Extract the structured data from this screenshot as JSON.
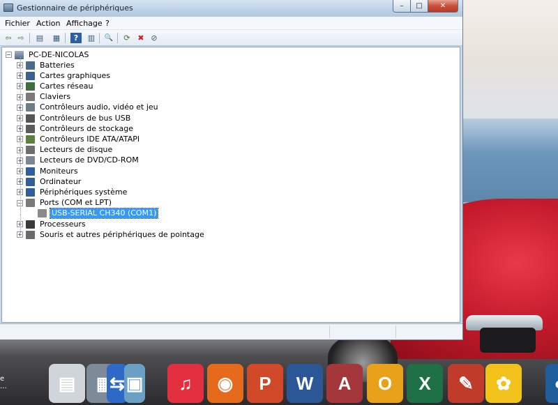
{
  "window": {
    "title": "Gestionnaire de périphériques",
    "buttons": {
      "minimize": "–",
      "maximize": "□",
      "close": "✕"
    }
  },
  "menu": {
    "items": [
      "Fichier",
      "Action",
      "Affichage",
      "?"
    ]
  },
  "toolbar": {
    "buttons": [
      {
        "name": "back-icon",
        "glyph": "⇦"
      },
      {
        "name": "forward-icon",
        "glyph": "⇨"
      },
      {
        "name": "show-hide-console-tree-icon",
        "glyph": "▤"
      },
      {
        "name": "properties-icon",
        "glyph": "▦"
      },
      {
        "name": "help-icon",
        "glyph": "?"
      },
      {
        "name": "view-icon",
        "glyph": "▥"
      },
      {
        "name": "scan-hardware-icon",
        "glyph": "🔍"
      },
      {
        "name": "update-driver-icon",
        "glyph": "⟳"
      },
      {
        "name": "uninstall-icon",
        "glyph": "✖"
      },
      {
        "name": "disable-icon",
        "glyph": "⊘"
      }
    ]
  },
  "tree": {
    "root": "PC-DE-NICOLAS",
    "nodes": [
      {
        "label": "Batteries",
        "expander": "+",
        "icon_color": "#4c6b8a"
      },
      {
        "label": "Cartes graphiques",
        "expander": "+",
        "icon_color": "#3b5f91"
      },
      {
        "label": "Cartes réseau",
        "expander": "+",
        "icon_color": "#3e6e3a"
      },
      {
        "label": "Claviers",
        "expander": "+",
        "icon_color": "#7a7a7a"
      },
      {
        "label": "Contrôleurs audio, vidéo et jeu",
        "expander": "+",
        "icon_color": "#6d7b88"
      },
      {
        "label": "Contrôleurs de bus USB",
        "expander": "+",
        "icon_color": "#555555"
      },
      {
        "label": "Contrôleurs de stockage",
        "expander": "+",
        "icon_color": "#5b5b5b"
      },
      {
        "label": "Contrôleurs IDE ATA/ATAPI",
        "expander": "+",
        "icon_color": "#5a7f3e"
      },
      {
        "label": "Lecteurs de disque",
        "expander": "+",
        "icon_color": "#6e6e6e"
      },
      {
        "label": "Lecteurs de DVD/CD-ROM",
        "expander": "+",
        "icon_color": "#7d8794"
      },
      {
        "label": "Moniteurs",
        "expander": "+",
        "icon_color": "#2f5d9e"
      },
      {
        "label": "Ordinateur",
        "expander": "+",
        "icon_color": "#2f5d9e"
      },
      {
        "label": "Périphériques système",
        "expander": "+",
        "icon_color": "#2f5d9e"
      },
      {
        "label": "Ports (COM et LPT)",
        "expander": "−",
        "icon_color": "#7a7a7a"
      },
      {
        "label": "USB-SERIAL CH340 (COM1)",
        "expander": "",
        "icon_color": "#8a8a8a",
        "selected": true,
        "child": true
      },
      {
        "label": "Processeurs",
        "expander": "+",
        "icon_color": "#3a3a3a"
      },
      {
        "label": "Souris et autres périphériques de pointage",
        "expander": "+",
        "icon_color": "#6a6a6a"
      }
    ]
  },
  "dock": {
    "apps": [
      {
        "name": "device-manager-app-icon",
        "glyph": "▤",
        "color": "#cfd5db"
      },
      {
        "name": "calculator-app-icon",
        "glyph": "▦",
        "color": "#7c8a99"
      },
      {
        "name": "sync-app-icon",
        "glyph": "⇆",
        "color": "#2e69c7"
      },
      {
        "name": "files-app-icon",
        "glyph": "▣",
        "color": "#6aa0c4"
      },
      {
        "name": "itunes-app-icon",
        "glyph": "♫",
        "color": "#e2303e"
      },
      {
        "name": "firefox-app-icon",
        "glyph": "◉",
        "color": "#e66a1b"
      },
      {
        "name": "powerpoint-app-icon",
        "glyph": "P",
        "color": "#d2492a"
      },
      {
        "name": "word-app-icon",
        "glyph": "W",
        "color": "#2b5797"
      },
      {
        "name": "access-app-icon",
        "glyph": "A",
        "color": "#a4373a"
      },
      {
        "name": "outlook-app-icon",
        "glyph": "O",
        "color": "#e8a21a"
      },
      {
        "name": "excel-app-icon",
        "glyph": "X",
        "color": "#1e7145"
      },
      {
        "name": "ccleaner-app-icon",
        "glyph": "✎",
        "color": "#c13b2a"
      },
      {
        "name": "sunflower-app-icon",
        "glyph": "✿",
        "color": "#f2c21b"
      },
      {
        "name": "partial-app-icon",
        "glyph": "◐",
        "color": "#1e5c9c"
      }
    ]
  },
  "desktop_edge_text": [
    "e",
    "..."
  ]
}
